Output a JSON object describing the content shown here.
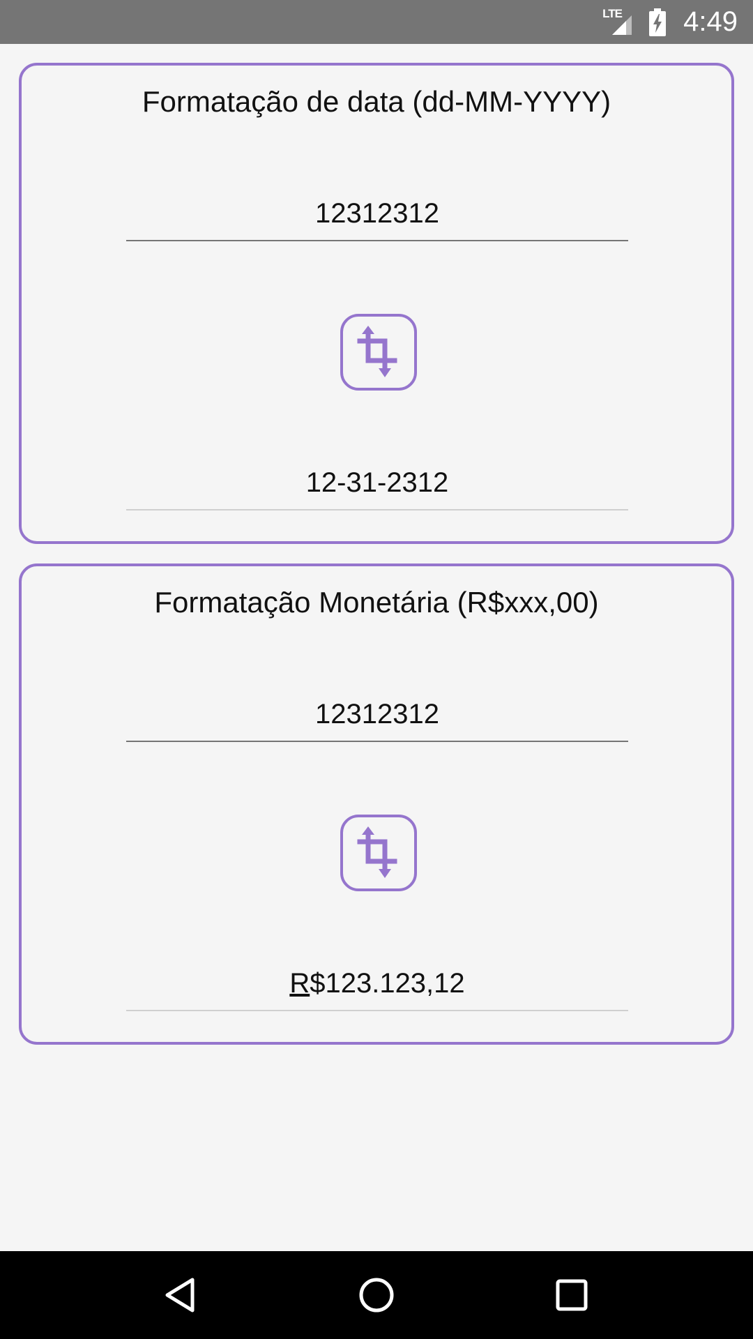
{
  "status_bar": {
    "network": "LTE",
    "time": "4:49",
    "icons": [
      "lte-signal-icon",
      "battery-charging-icon"
    ]
  },
  "date_card": {
    "title": "Formatação de data (dd-MM-YYYY)",
    "input_value": "12312312",
    "output_value": "12-31-2312",
    "button_icon": "crop-rotate-icon"
  },
  "money_card": {
    "title": "Formatação Monetária (R$xxx,00)",
    "input_value": "12312312",
    "output_first": "R",
    "output_rest": "$123.123,12",
    "button_icon": "crop-rotate-icon"
  },
  "nav_bar": {
    "icons": [
      "back-icon",
      "home-icon",
      "recents-icon"
    ]
  },
  "colors": {
    "accent": "#9575cd",
    "status_bar": "#757575",
    "background": "#f5f5f5",
    "nav_bar": "#000000"
  }
}
